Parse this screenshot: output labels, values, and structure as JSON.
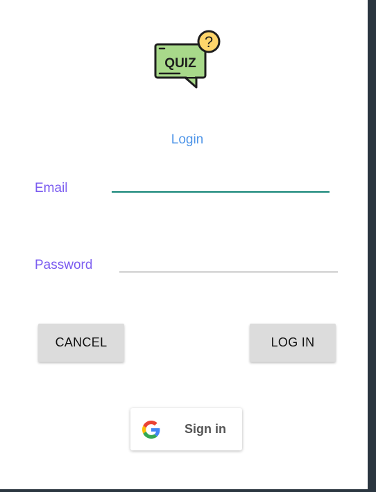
{
  "logo": {
    "icon": "quiz-logo-icon",
    "text": "QUIZ",
    "badge": "?"
  },
  "title": "Login",
  "form": {
    "email_label": "Email",
    "email_value": "",
    "password_label": "Password",
    "password_value": ""
  },
  "buttons": {
    "cancel_label": "CANCEL",
    "login_label": "LOG IN"
  },
  "google": {
    "icon": "google-g-icon",
    "label": "Sign in"
  },
  "colors": {
    "title": "#4e95e8",
    "label": "#7b5cf0",
    "focus_underline": "#128476",
    "button_bg": "#dcdcdc"
  }
}
